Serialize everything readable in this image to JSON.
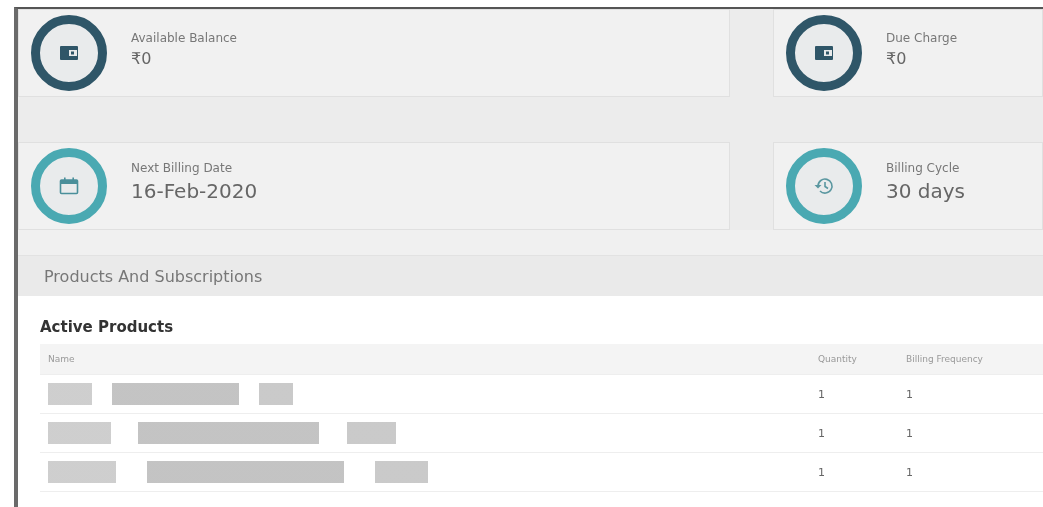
{
  "summary_cards": [
    {
      "kind": "wallet",
      "color": "#2f5668",
      "label": "Available Balance",
      "value": "₹0"
    },
    {
      "kind": "wallet",
      "color": "#2f5668",
      "label": "Due Charge",
      "value": "₹0"
    },
    {
      "kind": "calendar",
      "color": "#4aa9b2",
      "label": "Next Billing Date",
      "value": "16-Feb-2020"
    },
    {
      "kind": "history",
      "color": "#4aa9b2",
      "label": "Billing Cycle",
      "value": "30 days"
    }
  ],
  "section": {
    "title": "Products And Subscriptions"
  },
  "table": {
    "title": "Active Products",
    "columns": [
      "Name",
      "Quantity",
      "Billing Frequency"
    ],
    "rows": [
      {
        "quantity": "1",
        "billing_frequency": "1"
      },
      {
        "quantity": "1",
        "billing_frequency": "1"
      },
      {
        "quantity": "1",
        "billing_frequency": "1"
      }
    ]
  }
}
